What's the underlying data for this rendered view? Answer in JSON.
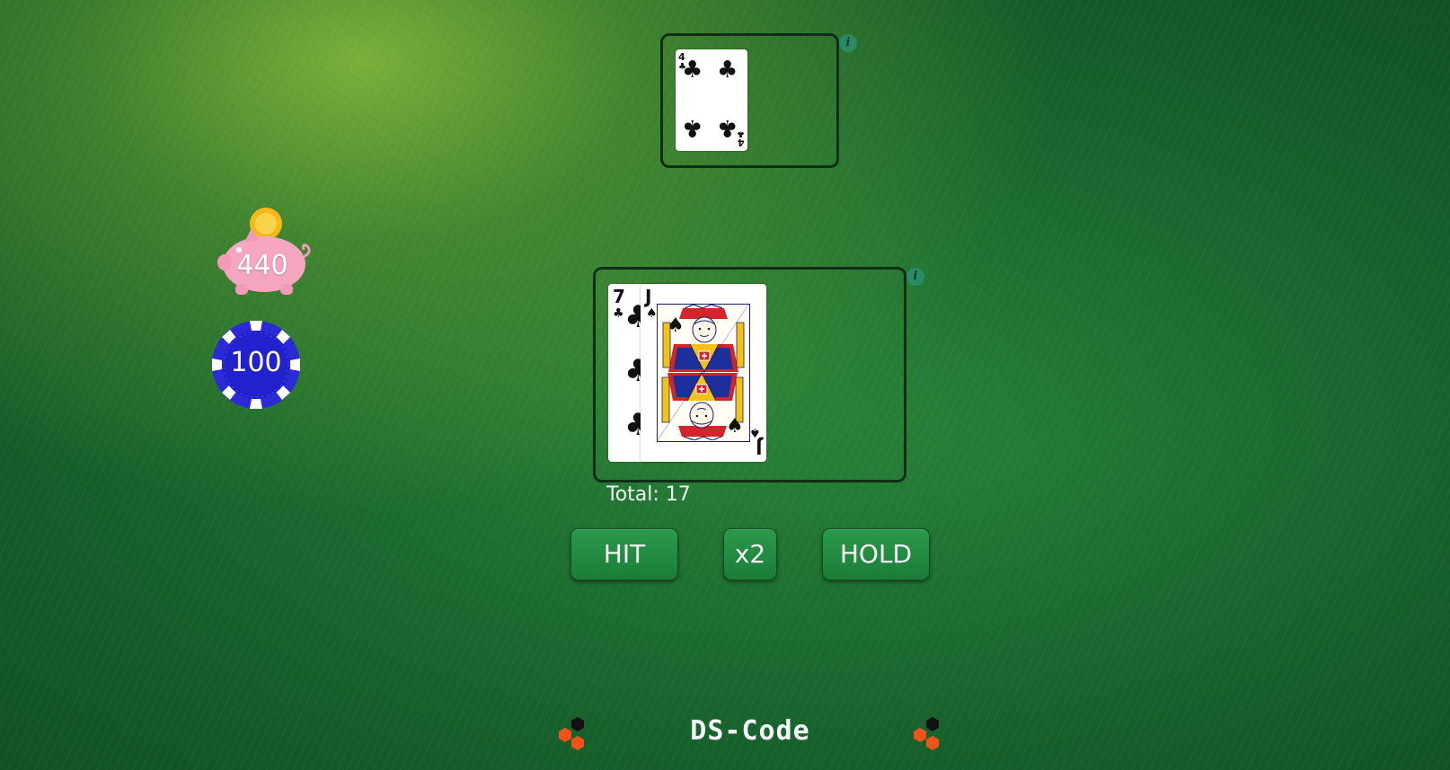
{
  "dealer": {
    "cards": [
      {
        "rank": "4",
        "suit": "♣",
        "suit_name": "clubs"
      }
    ]
  },
  "player": {
    "cards": [
      {
        "rank": "7",
        "suit": "♣",
        "suit_name": "clubs"
      },
      {
        "rank": "J",
        "suit": "♠",
        "suit_name": "spades"
      }
    ],
    "total_label": "Total: 17"
  },
  "bank": {
    "value": "440",
    "icon": "piggy-bank-icon"
  },
  "bet": {
    "value": "100",
    "icon": "poker-chip-icon"
  },
  "actions": {
    "hit_label": "HIT",
    "double_label": "x2",
    "hold_label": "HOLD"
  },
  "info_icon_glyph": "i",
  "footer": {
    "brand": "DS-Code"
  },
  "colors": {
    "button_green": "#1f8a40",
    "piggy_pink": "#f6a6c1",
    "coin_gold": "#f5c518",
    "chip_blue": "#2a2ad6",
    "logo_orange": "#f0521a",
    "logo_black": "#111111"
  }
}
